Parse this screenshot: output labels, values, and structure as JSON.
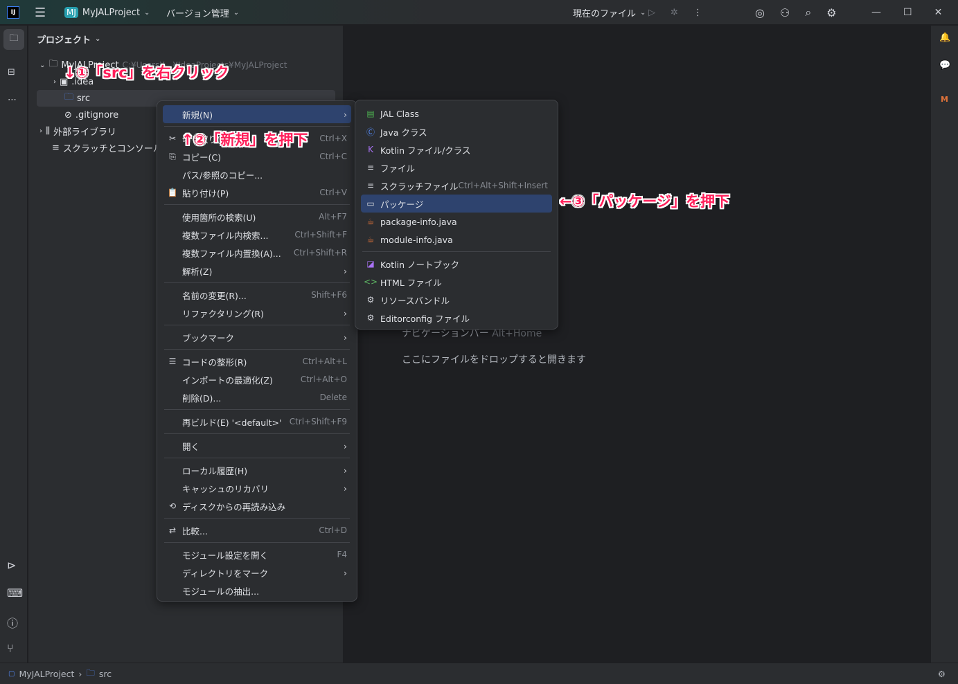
{
  "titlebar": {
    "project_badge": "MJ",
    "project": "MyJALProject",
    "vcs": "バージョン管理",
    "run_config": "現在のファイル"
  },
  "panel": {
    "title": "プロジェクト"
  },
  "tree": [
    {
      "label": "MyJALProject",
      "path": "C:¥Users¥...¥IdeaProjects¥MyJALProject"
    },
    {
      "label": ".idea"
    },
    {
      "label": "src"
    },
    {
      "label": ".gitignore"
    },
    {
      "label": "外部ライブラリ"
    },
    {
      "label": "スクラッチとコンソール"
    }
  ],
  "context_menu": [
    {
      "label": "新規(N)",
      "arrow": true,
      "selected": true
    },
    {
      "sep": true
    },
    {
      "label": "切り取り(T)",
      "icon": "✂",
      "shortcut": "Ctrl+X"
    },
    {
      "label": "コピー(C)",
      "icon": "⎘",
      "shortcut": "Ctrl+C"
    },
    {
      "label": "パス/参照のコピー..."
    },
    {
      "label": "貼り付け(P)",
      "icon": "📋",
      "shortcut": "Ctrl+V"
    },
    {
      "sep": true
    },
    {
      "label": "使用箇所の検索(U)",
      "shortcut": "Alt+F7"
    },
    {
      "label": "複数ファイル内検索...",
      "shortcut": "Ctrl+Shift+F"
    },
    {
      "label": "複数ファイル内置換(A)...",
      "shortcut": "Ctrl+Shift+R"
    },
    {
      "label": "解析(Z)",
      "arrow": true
    },
    {
      "sep": true
    },
    {
      "label": "名前の変更(R)...",
      "shortcut": "Shift+F6"
    },
    {
      "label": "リファクタリング(R)",
      "arrow": true
    },
    {
      "sep": true
    },
    {
      "label": "ブックマーク",
      "arrow": true
    },
    {
      "sep": true
    },
    {
      "label": "コードの整形(R)",
      "icon": "☰",
      "shortcut": "Ctrl+Alt+L"
    },
    {
      "label": "インポートの最適化(Z)",
      "shortcut": "Ctrl+Alt+O"
    },
    {
      "label": "削除(D)...",
      "shortcut": "Delete"
    },
    {
      "sep": true
    },
    {
      "label": "再ビルド(E) '<default>'",
      "shortcut": "Ctrl+Shift+F9"
    },
    {
      "sep": true
    },
    {
      "label": "開く",
      "arrow": true
    },
    {
      "sep": true
    },
    {
      "label": "ローカル履歴(H)",
      "arrow": true
    },
    {
      "label": "キャッシュのリカバリ",
      "arrow": true
    },
    {
      "label": "ディスクからの再読み込み",
      "icon": "⟲"
    },
    {
      "sep": true
    },
    {
      "label": "比較...",
      "icon": "⇄",
      "shortcut": "Ctrl+D"
    },
    {
      "sep": true
    },
    {
      "label": "モジュール設定を開く",
      "shortcut": "F4"
    },
    {
      "label": "ディレクトリをマーク",
      "arrow": true
    },
    {
      "label": "モジュールの抽出..."
    }
  ],
  "submenu": [
    {
      "label": "JAL Class",
      "icon": "▤",
      "color": "#4caf50"
    },
    {
      "label": "Java クラス",
      "icon": "Ⓒ",
      "color": "#548af7"
    },
    {
      "label": "Kotlin ファイル/クラス",
      "icon": "K",
      "color": "#a972f5"
    },
    {
      "label": "ファイル",
      "icon": "≡",
      "color": "#ced0d6"
    },
    {
      "label": "スクラッチファイル",
      "icon": "≡",
      "color": "#ced0d6",
      "shortcut": "Ctrl+Alt+Shift+Insert"
    },
    {
      "label": "パッケージ",
      "icon": "▭",
      "color": "#ced0d6",
      "selected": true
    },
    {
      "label": "package-info.java",
      "icon": "☕",
      "color": "#e0733a"
    },
    {
      "label": "module-info.java",
      "icon": "☕",
      "color": "#e0733a"
    },
    {
      "sep": true
    },
    {
      "label": "Kotlin ノートブック",
      "icon": "◪",
      "color": "#a972f5"
    },
    {
      "label": "HTML ファイル",
      "icon": "<>",
      "color": "#5fb865"
    },
    {
      "label": "リソースバンドル",
      "icon": "⚙",
      "color": "#ced0d6"
    },
    {
      "label": "Editorconfig ファイル",
      "icon": "⚙",
      "color": "#ced0d6"
    }
  ],
  "editor": {
    "hint_nav": "ナビゲーションバー",
    "hint_nav_sc": "Alt+Home",
    "hint_drop": "ここにファイルをドロップすると開きます"
  },
  "annotations": {
    "a1": "↓①「src」を右クリック",
    "a2": "↑②「新規」を押下",
    "a3": "←③「パッケージ」を押下"
  },
  "statusbar": {
    "project": "MyJALProject",
    "folder": "src"
  },
  "colors": {
    "accent": "#2e436e",
    "annotation": "#ff1f5a"
  }
}
